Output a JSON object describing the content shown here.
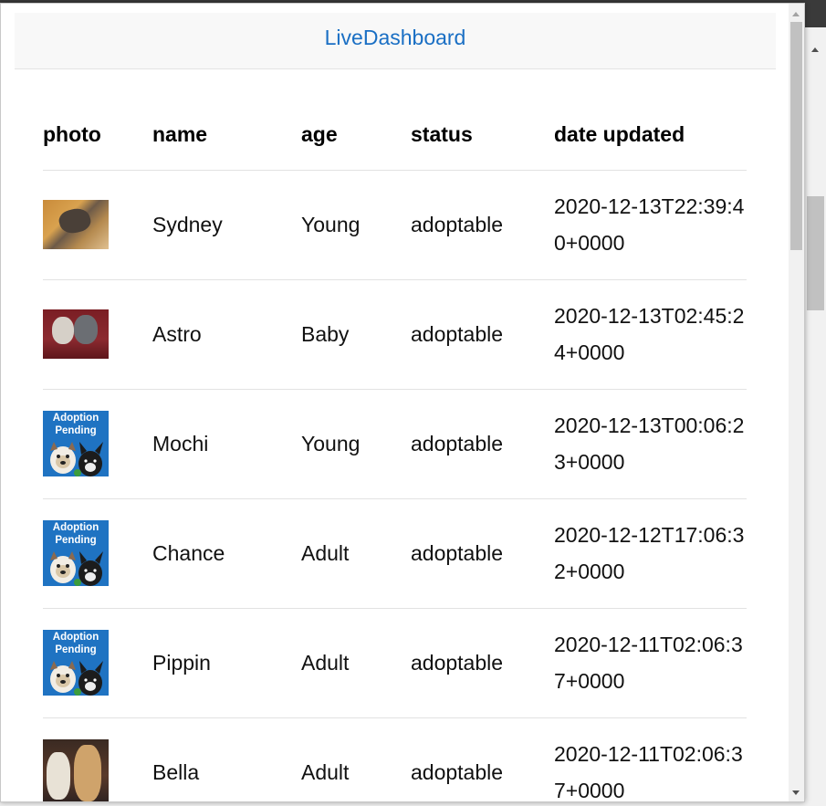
{
  "app": {
    "title": "LiveDashboard"
  },
  "table": {
    "headers": {
      "photo": "photo",
      "name": "name",
      "age": "age",
      "status": "status",
      "date_updated": "date updated"
    },
    "rows": [
      {
        "photo": "photo",
        "name": "Sydney",
        "age": "Young",
        "status": "adoptable",
        "date": "2020-12-13T22:39:40+0000"
      },
      {
        "photo": "photo",
        "name": "Astro",
        "age": "Baby",
        "status": "adoptable",
        "date": "2020-12-13T02:45:24+0000"
      },
      {
        "photo": "adoption-pending",
        "name": "Mochi",
        "age": "Young",
        "status": "adoptable",
        "date": "2020-12-13T00:06:23+0000"
      },
      {
        "photo": "adoption-pending",
        "name": "Chance",
        "age": "Adult",
        "status": "adoptable",
        "date": "2020-12-12T17:06:32+0000"
      },
      {
        "photo": "adoption-pending",
        "name": "Pippin",
        "age": "Adult",
        "status": "adoptable",
        "date": "2020-12-11T02:06:37+0000"
      },
      {
        "photo": "photo",
        "name": "Bella",
        "age": "Adult",
        "status": "adoptable",
        "date": "2020-12-11T02:06:37+0000"
      }
    ],
    "pending_badge": {
      "line1": "Adoption",
      "line2": "Pending"
    }
  },
  "colors": {
    "accent": "#1a6fc4",
    "badge_blue": "#1f73c2"
  }
}
